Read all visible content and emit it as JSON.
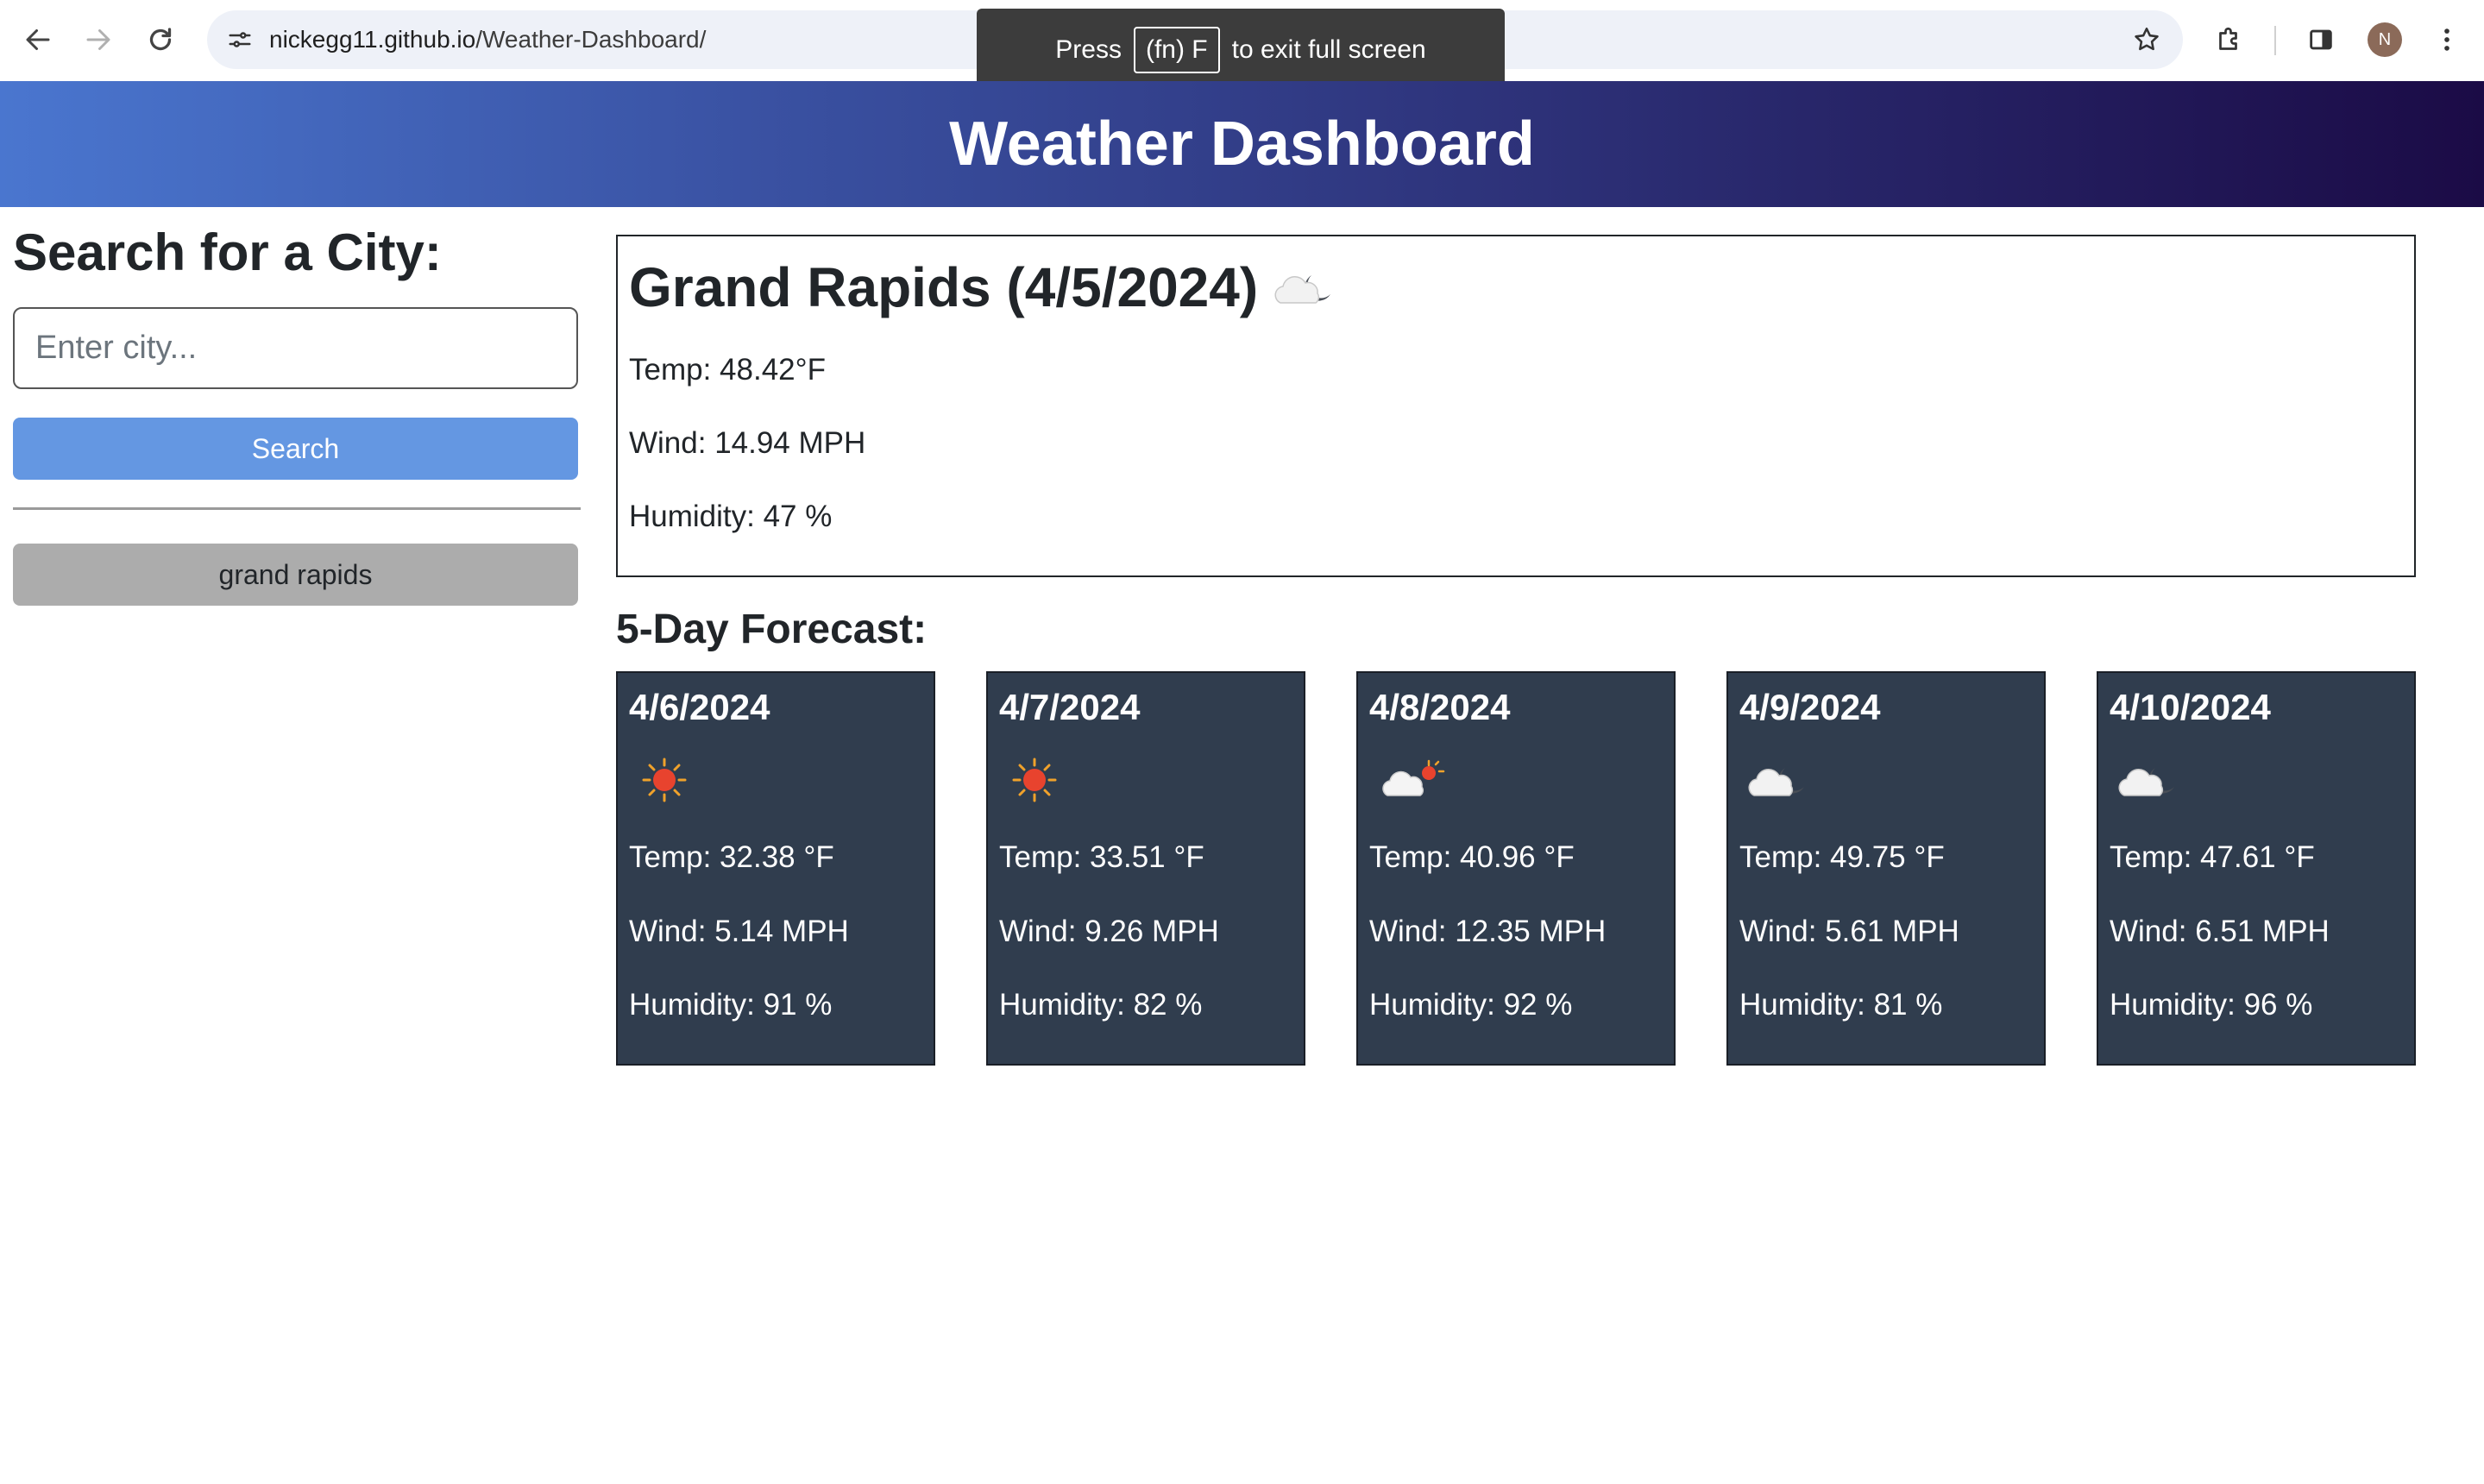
{
  "browser": {
    "url_host": "nickegg11.github.io",
    "url_path": "/Weather-Dashboard/",
    "avatar_initial": "N",
    "fullscreen_toast": {
      "prefix": "Press",
      "key": "(fn) F",
      "suffix": "to exit full screen"
    }
  },
  "header": {
    "title": "Weather Dashboard"
  },
  "sidebar": {
    "heading": "Search for a City:",
    "input_placeholder": "Enter city...",
    "input_value": "",
    "search_label": "Search",
    "history": [
      "grand rapids"
    ]
  },
  "current": {
    "title": "Grand Rapids (4/5/2024)",
    "icon": "cloudy-night-icon",
    "temp": "Temp: 48.42°F",
    "wind": "Wind: 14.94 MPH",
    "humidity": "Humidity: 47 %"
  },
  "forecast": {
    "heading": "5-Day Forecast:",
    "days": [
      {
        "date": "4/6/2024",
        "icon": "sun-icon",
        "temp": "Temp: 32.38 °F",
        "wind": "Wind: 5.14 MPH",
        "humidity": "Humidity: 91 %"
      },
      {
        "date": "4/7/2024",
        "icon": "sun-icon",
        "temp": "Temp: 33.51 °F",
        "wind": "Wind: 9.26 MPH",
        "humidity": "Humidity: 82 %"
      },
      {
        "date": "4/8/2024",
        "icon": "partly-cloudy-icon",
        "temp": "Temp: 40.96 °F",
        "wind": "Wind: 12.35 MPH",
        "humidity": "Humidity: 92 %"
      },
      {
        "date": "4/9/2024",
        "icon": "cloudy-night-icon",
        "temp": "Temp: 49.75 °F",
        "wind": "Wind: 5.61 MPH",
        "humidity": "Humidity: 81 %"
      },
      {
        "date": "4/10/2024",
        "icon": "cloudy-night-icon",
        "temp": "Temp: 47.61 °F",
        "wind": "Wind: 6.51 MPH",
        "humidity": "Humidity: 96 %"
      }
    ]
  },
  "colors": {
    "header_gradient_start": "#4a76cf",
    "header_gradient_end": "#1b0b46",
    "search_button": "#6497e2",
    "history_button": "#acacac",
    "forecast_card": "#303d4e"
  }
}
